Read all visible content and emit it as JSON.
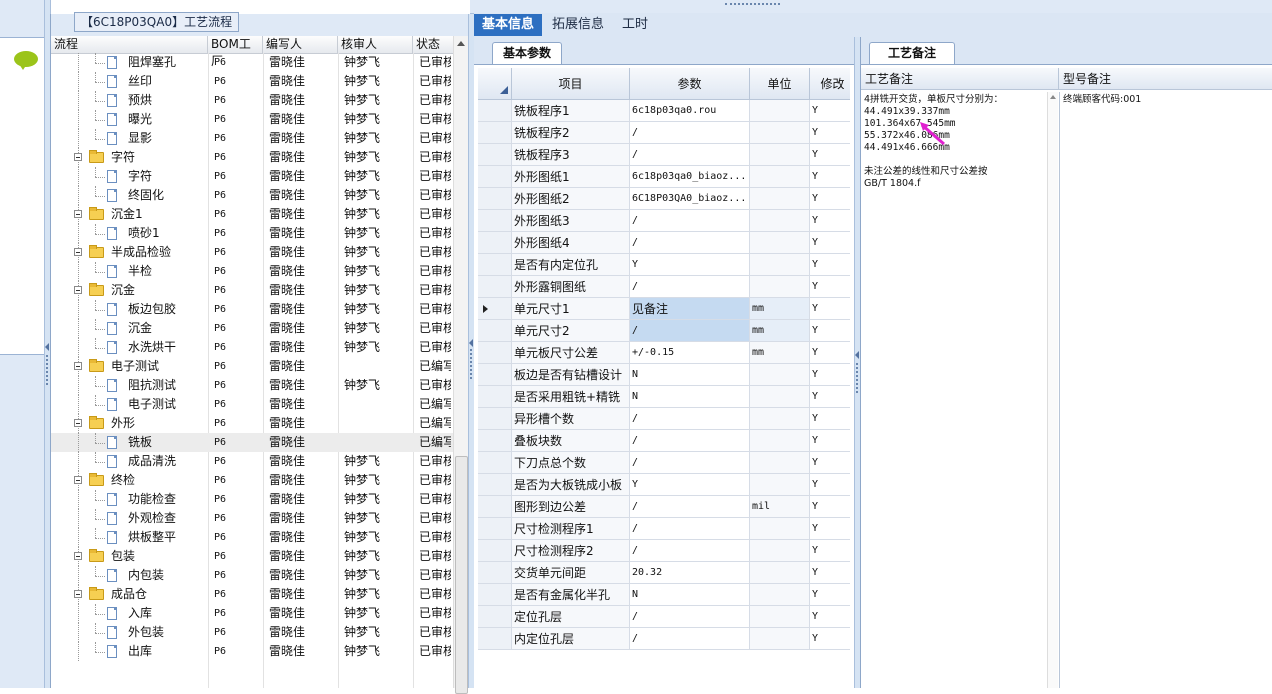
{
  "tree": {
    "title": "【6C18P03QA0】工艺流程",
    "columns": [
      "流程",
      "BOM工厂",
      "编写人",
      "核审人",
      "状态"
    ],
    "rows": [
      {
        "level": 2,
        "type": "item",
        "name": "阻焊塞孔",
        "bom": "P6",
        "author": "雷晓佳",
        "reviewer": "钟梦飞",
        "status": "已审核"
      },
      {
        "level": 2,
        "type": "item",
        "name": "丝印",
        "bom": "P6",
        "author": "雷晓佳",
        "reviewer": "钟梦飞",
        "status": "已审核"
      },
      {
        "level": 2,
        "type": "item",
        "name": "预烘",
        "bom": "P6",
        "author": "雷晓佳",
        "reviewer": "钟梦飞",
        "status": "已审核"
      },
      {
        "level": 2,
        "type": "item",
        "name": "曝光",
        "bom": "P6",
        "author": "雷晓佳",
        "reviewer": "钟梦飞",
        "status": "已审核"
      },
      {
        "level": 2,
        "type": "item",
        "name": "显影",
        "bom": "P6",
        "author": "雷晓佳",
        "reviewer": "钟梦飞",
        "status": "已审核"
      },
      {
        "level": 1,
        "type": "folder",
        "name": "字符",
        "bom": "P6",
        "author": "雷晓佳",
        "reviewer": "钟梦飞",
        "status": "已审核"
      },
      {
        "level": 2,
        "type": "item",
        "name": "字符",
        "bom": "P6",
        "author": "雷晓佳",
        "reviewer": "钟梦飞",
        "status": "已审核"
      },
      {
        "level": 2,
        "type": "item",
        "name": "终固化",
        "bom": "P6",
        "author": "雷晓佳",
        "reviewer": "钟梦飞",
        "status": "已审核"
      },
      {
        "level": 1,
        "type": "folder",
        "name": "沉金1",
        "bom": "P6",
        "author": "雷晓佳",
        "reviewer": "钟梦飞",
        "status": "已审核"
      },
      {
        "level": 2,
        "type": "item",
        "name": "喷砂1",
        "bom": "P6",
        "author": "雷晓佳",
        "reviewer": "钟梦飞",
        "status": "已审核"
      },
      {
        "level": 1,
        "type": "folder",
        "name": "半成品检验",
        "bom": "P6",
        "author": "雷晓佳",
        "reviewer": "钟梦飞",
        "status": "已审核"
      },
      {
        "level": 2,
        "type": "item",
        "name": "半检",
        "bom": "P6",
        "author": "雷晓佳",
        "reviewer": "钟梦飞",
        "status": "已审核"
      },
      {
        "level": 1,
        "type": "folder",
        "name": "沉金",
        "bom": "P6",
        "author": "雷晓佳",
        "reviewer": "钟梦飞",
        "status": "已审核"
      },
      {
        "level": 2,
        "type": "item",
        "name": "板边包胶",
        "bom": "P6",
        "author": "雷晓佳",
        "reviewer": "钟梦飞",
        "status": "已审核"
      },
      {
        "level": 2,
        "type": "item",
        "name": "沉金",
        "bom": "P6",
        "author": "雷晓佳",
        "reviewer": "钟梦飞",
        "status": "已审核"
      },
      {
        "level": 2,
        "type": "item",
        "name": "水洗烘干",
        "bom": "P6",
        "author": "雷晓佳",
        "reviewer": "钟梦飞",
        "status": "已审核"
      },
      {
        "level": 1,
        "type": "folder",
        "name": "电子测试",
        "bom": "P6",
        "author": "雷晓佳",
        "reviewer": "",
        "status": "已编写"
      },
      {
        "level": 2,
        "type": "item",
        "name": "阻抗测试",
        "bom": "P6",
        "author": "雷晓佳",
        "reviewer": "钟梦飞",
        "status": "已审核"
      },
      {
        "level": 2,
        "type": "item",
        "name": "电子测试",
        "bom": "P6",
        "author": "雷晓佳",
        "reviewer": "",
        "status": "已编写"
      },
      {
        "level": 1,
        "type": "folder",
        "name": "外形",
        "bom": "P6",
        "author": "雷晓佳",
        "reviewer": "",
        "status": "已编写"
      },
      {
        "level": 2,
        "type": "item",
        "name": "铣板",
        "bom": "P6",
        "author": "雷晓佳",
        "reviewer": "",
        "status": "已编写",
        "selected": true
      },
      {
        "level": 2,
        "type": "item",
        "name": "成品清洗",
        "bom": "P6",
        "author": "雷晓佳",
        "reviewer": "钟梦飞",
        "status": "已审核"
      },
      {
        "level": 1,
        "type": "folder",
        "name": "终检",
        "bom": "P6",
        "author": "雷晓佳",
        "reviewer": "钟梦飞",
        "status": "已审核"
      },
      {
        "level": 2,
        "type": "item",
        "name": "功能检查",
        "bom": "P6",
        "author": "雷晓佳",
        "reviewer": "钟梦飞",
        "status": "已审核"
      },
      {
        "level": 2,
        "type": "item",
        "name": "外观检查",
        "bom": "P6",
        "author": "雷晓佳",
        "reviewer": "钟梦飞",
        "status": "已审核"
      },
      {
        "level": 2,
        "type": "item",
        "name": "烘板整平",
        "bom": "P6",
        "author": "雷晓佳",
        "reviewer": "钟梦飞",
        "status": "已审核"
      },
      {
        "level": 1,
        "type": "folder",
        "name": "包装",
        "bom": "P6",
        "author": "雷晓佳",
        "reviewer": "钟梦飞",
        "status": "已审核"
      },
      {
        "level": 2,
        "type": "item",
        "name": "内包装",
        "bom": "P6",
        "author": "雷晓佳",
        "reviewer": "钟梦飞",
        "status": "已审核"
      },
      {
        "level": 1,
        "type": "folder",
        "name": "成品仓",
        "bom": "P6",
        "author": "雷晓佳",
        "reviewer": "钟梦飞",
        "status": "已审核"
      },
      {
        "level": 2,
        "type": "item",
        "name": "入库",
        "bom": "P6",
        "author": "雷晓佳",
        "reviewer": "钟梦飞",
        "status": "已审核"
      },
      {
        "level": 2,
        "type": "item",
        "name": "外包装",
        "bom": "P6",
        "author": "雷晓佳",
        "reviewer": "钟梦飞",
        "status": "已审核"
      },
      {
        "level": 2,
        "type": "item",
        "name": "出库",
        "bom": "P6",
        "author": "雷晓佳",
        "reviewer": "钟梦飞",
        "status": "已审核"
      }
    ]
  },
  "top_tabs": [
    "基本信息",
    "拓展信息",
    "工时"
  ],
  "top_tab_active": 0,
  "params": {
    "tab": "基本参数",
    "columns": [
      "项目",
      "参数",
      "单位",
      "修改"
    ],
    "rows": [
      {
        "item": "铣板程序1",
        "value": "6c18p03qa0.rou",
        "unit": "",
        "mod": "Y"
      },
      {
        "item": "铣板程序2",
        "value": "/",
        "unit": "",
        "mod": "Y"
      },
      {
        "item": "铣板程序3",
        "value": "/",
        "unit": "",
        "mod": "Y"
      },
      {
        "item": "外形图纸1",
        "value": "6c18p03qa0_biaoz...",
        "unit": "",
        "mod": "Y"
      },
      {
        "item": "外形图纸2",
        "value": "6C18P03QA0_biaoz...",
        "unit": "",
        "mod": "Y"
      },
      {
        "item": "外形图纸3",
        "value": "/",
        "unit": "",
        "mod": "Y"
      },
      {
        "item": "外形图纸4",
        "value": "/",
        "unit": "",
        "mod": "Y"
      },
      {
        "item": "是否有内定位孔",
        "value": "Y",
        "unit": "",
        "mod": "Y"
      },
      {
        "item": "外形露铜图纸",
        "value": "/",
        "unit": "",
        "mod": "Y"
      },
      {
        "item": "单元尺寸1",
        "value": "见备注",
        "unit": "mm",
        "mod": "Y",
        "current": true,
        "hl": true
      },
      {
        "item": "单元尺寸2",
        "value": "/",
        "unit": "mm",
        "mod": "Y",
        "hl": true
      },
      {
        "item": "单元板尺寸公差",
        "value": "+/-0.15",
        "unit": "mm",
        "mod": "Y"
      },
      {
        "item": "板边是否有钻槽设计",
        "value": "N",
        "unit": "",
        "mod": "Y"
      },
      {
        "item": "是否采用粗铣+精铣",
        "value": "N",
        "unit": "",
        "mod": "Y"
      },
      {
        "item": "异形槽个数",
        "value": "/",
        "unit": "",
        "mod": "Y"
      },
      {
        "item": "叠板块数",
        "value": "/",
        "unit": "",
        "mod": "Y"
      },
      {
        "item": "下刀点总个数",
        "value": "/",
        "unit": "",
        "mod": "Y"
      },
      {
        "item": "是否为大板铣成小板",
        "value": "Y",
        "unit": "",
        "mod": "Y"
      },
      {
        "item": "图形到边公差",
        "value": "/",
        "unit": "mil",
        "mod": "Y"
      },
      {
        "item": "尺寸检测程序1",
        "value": "/",
        "unit": "",
        "mod": "Y"
      },
      {
        "item": "尺寸检测程序2",
        "value": "/",
        "unit": "",
        "mod": "Y"
      },
      {
        "item": "交货单元间距",
        "value": "20.32",
        "unit": "",
        "mod": "Y"
      },
      {
        "item": "是否有金属化半孔",
        "value": "N",
        "unit": "",
        "mod": "Y"
      },
      {
        "item": "定位孔层",
        "value": "/",
        "unit": "",
        "mod": "Y"
      },
      {
        "item": "内定位孔层",
        "value": "/",
        "unit": "",
        "mod": "Y"
      }
    ]
  },
  "remarks": {
    "tab": "工艺备注",
    "process_header": "工艺备注",
    "model_header": "型号备注",
    "process_lines": [
      "4拼铣开交货，单板尺寸分别为：",
      "44.491x39.337mm",
      "101.364x67.545mm",
      "55.372x46.086mm",
      "44.491x46.666mm",
      "",
      "未注公差的线性和尺寸公差按",
      "GB/T 1804.f"
    ],
    "model_lines": [
      "终端顾客代码:001"
    ],
    "cursor_color": "#e020d0"
  }
}
